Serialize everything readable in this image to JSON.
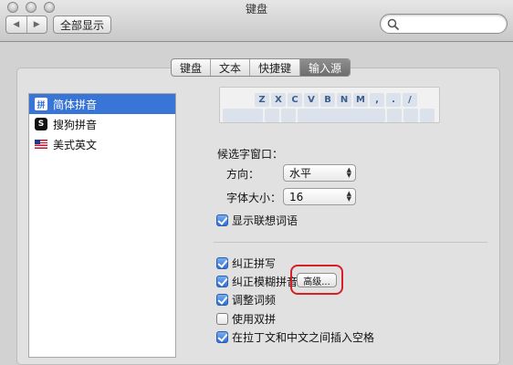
{
  "window": {
    "title": "键盘",
    "show_all_label": "全部显示",
    "search_placeholder": ""
  },
  "tabs": [
    {
      "label": "键盘"
    },
    {
      "label": "文本"
    },
    {
      "label": "快捷键"
    },
    {
      "label": "输入源",
      "active": true
    }
  ],
  "input_sources": [
    {
      "label": "简体拼音",
      "icon": "pinyin-icon",
      "icon_glyph": "拼",
      "selected": true
    },
    {
      "label": "搜狗拼音",
      "icon": "sogou-icon",
      "icon_glyph": "S",
      "selected": false
    },
    {
      "label": "美式英文",
      "icon": "us-flag-icon",
      "icon_glyph": "",
      "selected": false
    }
  ],
  "keyboard": {
    "top_row": [
      "Z",
      "X",
      "C",
      "V",
      "B",
      "N",
      "M",
      ",",
      ".",
      "/"
    ]
  },
  "candidate_window": {
    "heading": "候选字窗口：",
    "orientation_label": "方向：",
    "orientation_value": "水平",
    "font_size_label": "字体大小：",
    "font_size_value": "16"
  },
  "options": {
    "show_suggestions": {
      "label": "显示联想词语",
      "checked": true
    },
    "correct_spelling": {
      "label": "纠正拼写",
      "checked": true
    },
    "fuzzy_pinyin": {
      "label": "纠正模糊拼音",
      "checked": true
    },
    "advanced_button": "高级...",
    "adjust_frequency": {
      "label": "调整词频",
      "checked": true
    },
    "double_pinyin": {
      "label": "使用双拼",
      "checked": false
    },
    "insert_space": {
      "label": "在拉丁文和中文之间插入空格",
      "checked": true
    }
  },
  "colors": {
    "selection": "#3875d7",
    "checkbox": "#2d6fd6",
    "highlight_ring": "#d71f28"
  }
}
